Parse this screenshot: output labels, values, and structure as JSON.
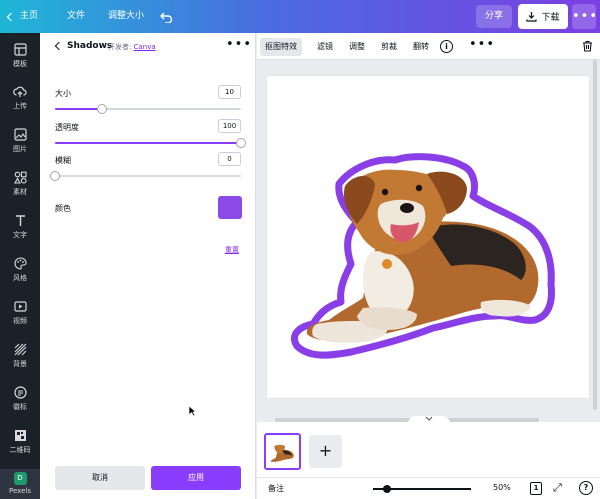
{
  "topbar": {
    "home_label": "主页",
    "file_label": "文件",
    "resize_label": "调整大小",
    "undo_icon": "undo-icon",
    "share_label": "分享",
    "download_label": "下载",
    "more_label": "•••",
    "gradient_colors": [
      "#1fb6d6",
      "#4b6be0",
      "#7b3fe4"
    ]
  },
  "sidenav": {
    "items": [
      {
        "label": "模板",
        "icon": "template-icon"
      },
      {
        "label": "上传",
        "icon": "upload-icon"
      },
      {
        "label": "图片",
        "icon": "image-icon"
      },
      {
        "label": "素材",
        "icon": "elements-icon"
      },
      {
        "label": "文字",
        "icon": "text-icon"
      },
      {
        "label": "风格",
        "icon": "palette-icon"
      },
      {
        "label": "视频",
        "icon": "video-icon"
      },
      {
        "label": "背景",
        "icon": "background-icon"
      },
      {
        "label": "徽标",
        "icon": "logo-icon"
      },
      {
        "label": "二维码",
        "icon": "qrcode-icon"
      },
      {
        "label": "Pexels",
        "icon": "pexels-icon",
        "badge": "D"
      }
    ]
  },
  "panel": {
    "title": "Shadows",
    "developer_prefix": "开发者:",
    "developer_link": "Canva",
    "more_label": "•••",
    "size": {
      "label": "大小",
      "value": "10",
      "fraction": 0.25
    },
    "opacity": {
      "label": "透明度",
      "value": "100",
      "fraction": 1.0
    },
    "blur": {
      "label": "模糊",
      "value": "0",
      "fraction": 0.0
    },
    "color": {
      "label": "颜色",
      "swatch": "#8b4ae8"
    },
    "reset_label": "重置",
    "cancel_label": "取消",
    "apply_label": "应用",
    "accent": "#8b3dff"
  },
  "edit_toolbar": {
    "items": [
      "抠图特效",
      "滤镜",
      "调整",
      "剪裁",
      "翻转"
    ],
    "active_index": 0,
    "info_label": "i",
    "more_label": "•••",
    "trash_icon": "trash-icon"
  },
  "footer": {
    "notes_label": "备注",
    "zoom_label": "50%",
    "zoom_fraction": 0.14,
    "page_count": "1",
    "help_label": "?"
  },
  "pages": {
    "add_label": "+"
  }
}
